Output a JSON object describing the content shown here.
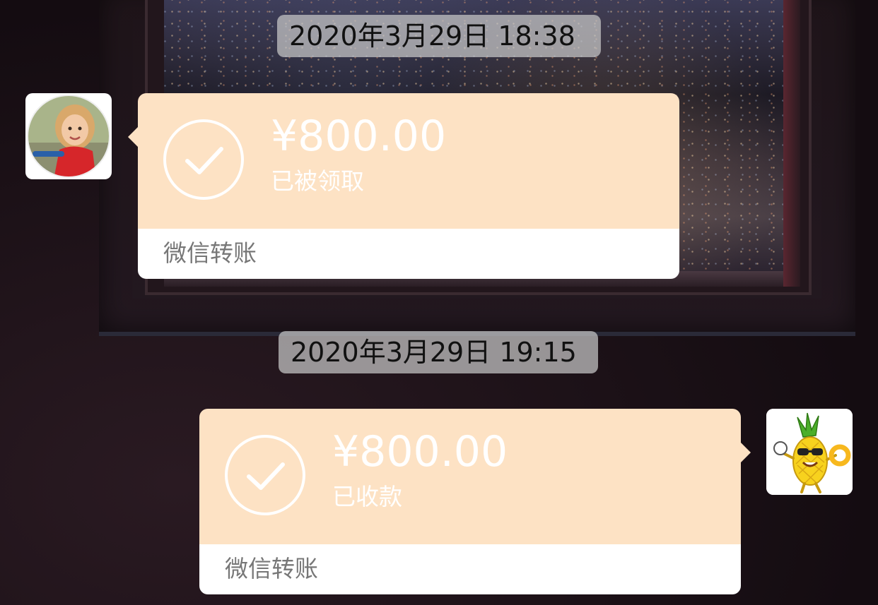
{
  "messages": [
    {
      "timestamp": "2020年3月29日 18:38",
      "side": "left",
      "avatar_icon": "child-avatar-icon",
      "transfer": {
        "amount": "¥800.00",
        "status": "已被领取",
        "label": "微信转账"
      }
    },
    {
      "timestamp": "2020年3月29日 19:15",
      "side": "right",
      "avatar_icon": "pineapple-avatar-icon",
      "transfer": {
        "amount": "¥800.00",
        "status": "已收款",
        "label": "微信转账"
      }
    }
  ],
  "colors": {
    "bubble_accent": "#fde2c4",
    "bubble_footer": "#ffffff",
    "timestamp_bg": "#c8c8c8",
    "label_text": "#777777"
  }
}
